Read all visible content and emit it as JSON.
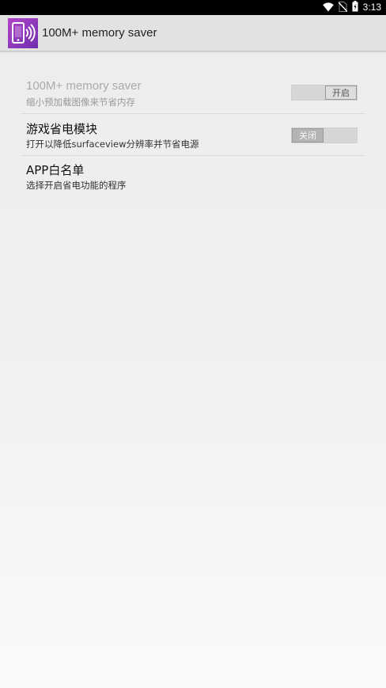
{
  "status_bar": {
    "time": "3:13",
    "icons": [
      "wifi-icon",
      "no-sim-icon",
      "battery-icon"
    ]
  },
  "action_bar": {
    "app_icon": "phone-signal-icon",
    "title": "100M+ memory saver"
  },
  "preferences": [
    {
      "title": "100M+ memory saver",
      "summary": "缩小预加载图像来节省内存",
      "enabled": false,
      "toggle": {
        "state": "on",
        "label": "开启"
      }
    },
    {
      "title": "游戏省电模块",
      "summary": "打开以降低surfaceview分辨率并节省电源",
      "enabled": true,
      "toggle": {
        "state": "off",
        "label": "关闭"
      }
    },
    {
      "title": "APP白名单",
      "summary": "选择开启省电功能的程序",
      "enabled": true
    }
  ],
  "colors": {
    "status_bar_bg": "#000000",
    "action_bar_bg": "#e2e2e2",
    "app_icon_gradient": [
      "#b344c9",
      "#6e2fae"
    ],
    "disabled_text": "#aaaaaa"
  }
}
